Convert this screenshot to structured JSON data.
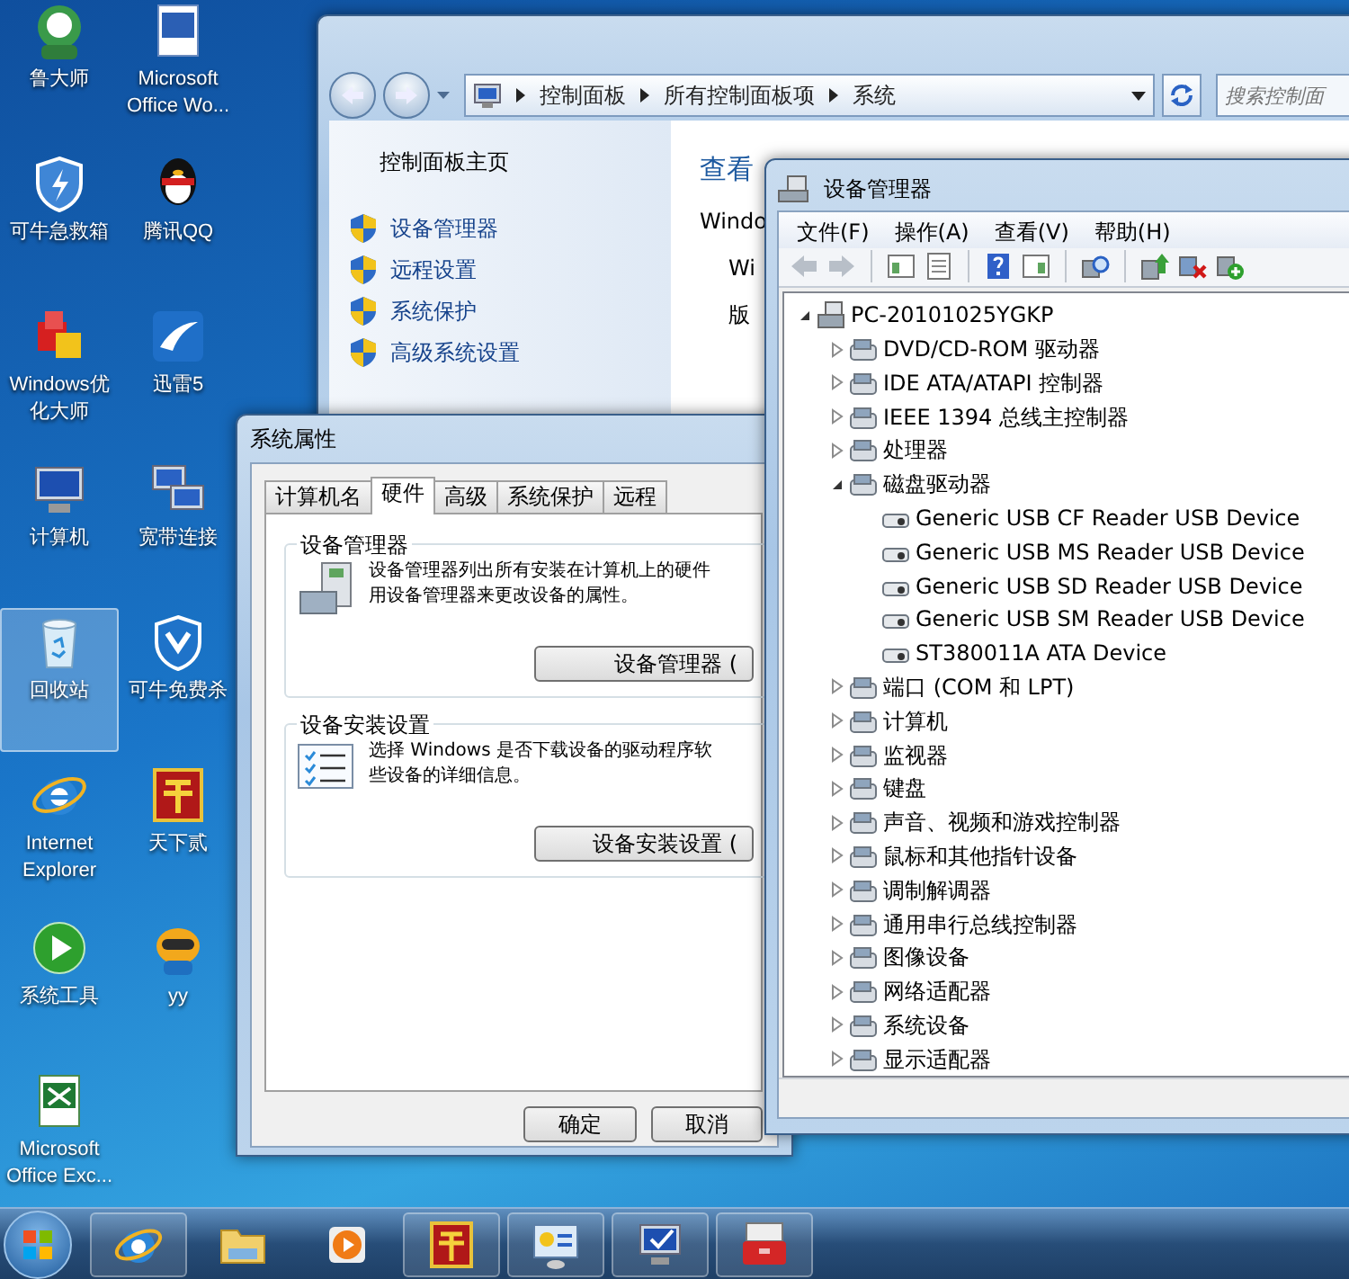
{
  "desktop_icons": [
    {
      "label": "鲁大师",
      "selected": false
    },
    {
      "label": "Microsoft Office Wo...",
      "selected": false
    },
    {
      "label": "可牛急救箱",
      "selected": false
    },
    {
      "label": "腾讯QQ",
      "selected": false
    },
    {
      "label": "Windows优化大师",
      "selected": false
    },
    {
      "label": "迅雷5",
      "selected": false
    },
    {
      "label": "计算机",
      "selected": false
    },
    {
      "label": "宽带连接",
      "selected": false
    },
    {
      "label": "回收站",
      "selected": true
    },
    {
      "label": "可牛免费杀",
      "selected": false
    },
    {
      "label": "Internet Explorer",
      "selected": false
    },
    {
      "label": "天下贰",
      "selected": false
    },
    {
      "label": "系统工具",
      "selected": false
    },
    {
      "label": "yy",
      "selected": false
    },
    {
      "label": "Microsoft Office Exc...",
      "selected": false
    }
  ],
  "control_panel": {
    "address": [
      "控制面板",
      "所有控制面板项",
      "系统"
    ],
    "search": {
      "placeholder": "搜索控制面"
    },
    "home_link": "控制面板主页",
    "tasks": [
      "设备管理器",
      "远程设置",
      "系统保护",
      "高级系统设置"
    ],
    "heading": "查看",
    "section": "Windo",
    "items": [
      "Wi",
      "版"
    ]
  },
  "system_properties": {
    "title": "系统属性",
    "tabs": [
      {
        "label": "计算机名",
        "selected": false
      },
      {
        "label": "硬件",
        "selected": true
      },
      {
        "label": "高级",
        "selected": false
      },
      {
        "label": "系统保护",
        "selected": false
      },
      {
        "label": "远程",
        "selected": false
      }
    ],
    "groups": [
      {
        "legend": "设备管理器",
        "description": [
          "设备管理器列出所有安装在计算机上的硬件",
          "用设备管理器来更改设备的属性。"
        ],
        "button": "设备管理器 ("
      },
      {
        "legend": "设备安装设置",
        "description": [
          "选择 Windows 是否下载设备的驱动程序软",
          "些设备的详细信息。"
        ],
        "button": "设备安装设置 ("
      }
    ],
    "buttons": [
      "确定",
      "取消"
    ]
  },
  "device_manager": {
    "title": "设备管理器",
    "menu": [
      "文件(F)",
      "操作(A)",
      "查看(V)",
      "帮助(H)"
    ],
    "tree": {
      "label": "PC-20101025YGKP",
      "expanded": true,
      "children": [
        {
          "label": "DVD/CD-ROM 驱动器",
          "expanded": false
        },
        {
          "label": "IDE ATA/ATAPI 控制器",
          "expanded": false
        },
        {
          "label": "IEEE 1394 总线主控制器",
          "expanded": false
        },
        {
          "label": "处理器",
          "expanded": false
        },
        {
          "label": "磁盘驱动器",
          "expanded": true,
          "children": [
            {
              "label": "Generic USB CF Reader USB Device"
            },
            {
              "label": "Generic USB MS Reader USB Device"
            },
            {
              "label": "Generic USB SD Reader USB Device"
            },
            {
              "label": "Generic USB SM Reader USB Device"
            },
            {
              "label": "ST380011A ATA Device"
            }
          ]
        },
        {
          "label": "端口 (COM 和 LPT)",
          "expanded": false
        },
        {
          "label": "计算机",
          "expanded": false
        },
        {
          "label": "监视器",
          "expanded": false
        },
        {
          "label": "键盘",
          "expanded": false
        },
        {
          "label": "声音、视频和游戏控制器",
          "expanded": false
        },
        {
          "label": "鼠标和其他指针设备",
          "expanded": false
        },
        {
          "label": "调制解调器",
          "expanded": false
        },
        {
          "label": "通用串行总线控制器",
          "expanded": false
        },
        {
          "label": "图像设备",
          "expanded": false
        },
        {
          "label": "网络适配器",
          "expanded": false
        },
        {
          "label": "系统设备",
          "expanded": false
        },
        {
          "label": "显示适配器",
          "expanded": false
        }
      ]
    }
  }
}
